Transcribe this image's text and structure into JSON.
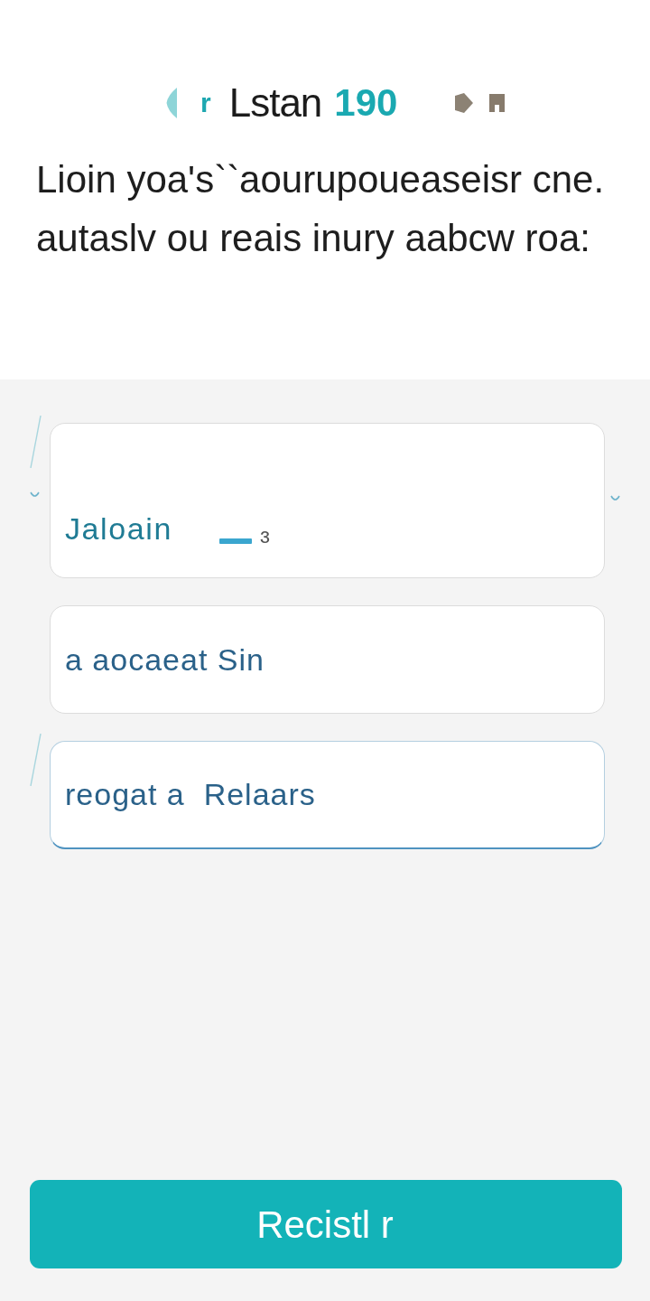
{
  "header": {
    "mark": "r",
    "title": "Lstan",
    "number": "190"
  },
  "description": {
    "lines": [
      "Lioin yoa's``aourupoueaseisr cne.",
      "autaslv ou reais inury aabcw roa:"
    ]
  },
  "fields": [
    {
      "value": "Jaloain",
      "suffix": "ɜ",
      "focused": false
    },
    {
      "value": "a aocaeat Sin",
      "focused": false
    },
    {
      "value": "reogat a  Relaars",
      "focused": true
    }
  ],
  "button": {
    "label": "Recistl r"
  }
}
